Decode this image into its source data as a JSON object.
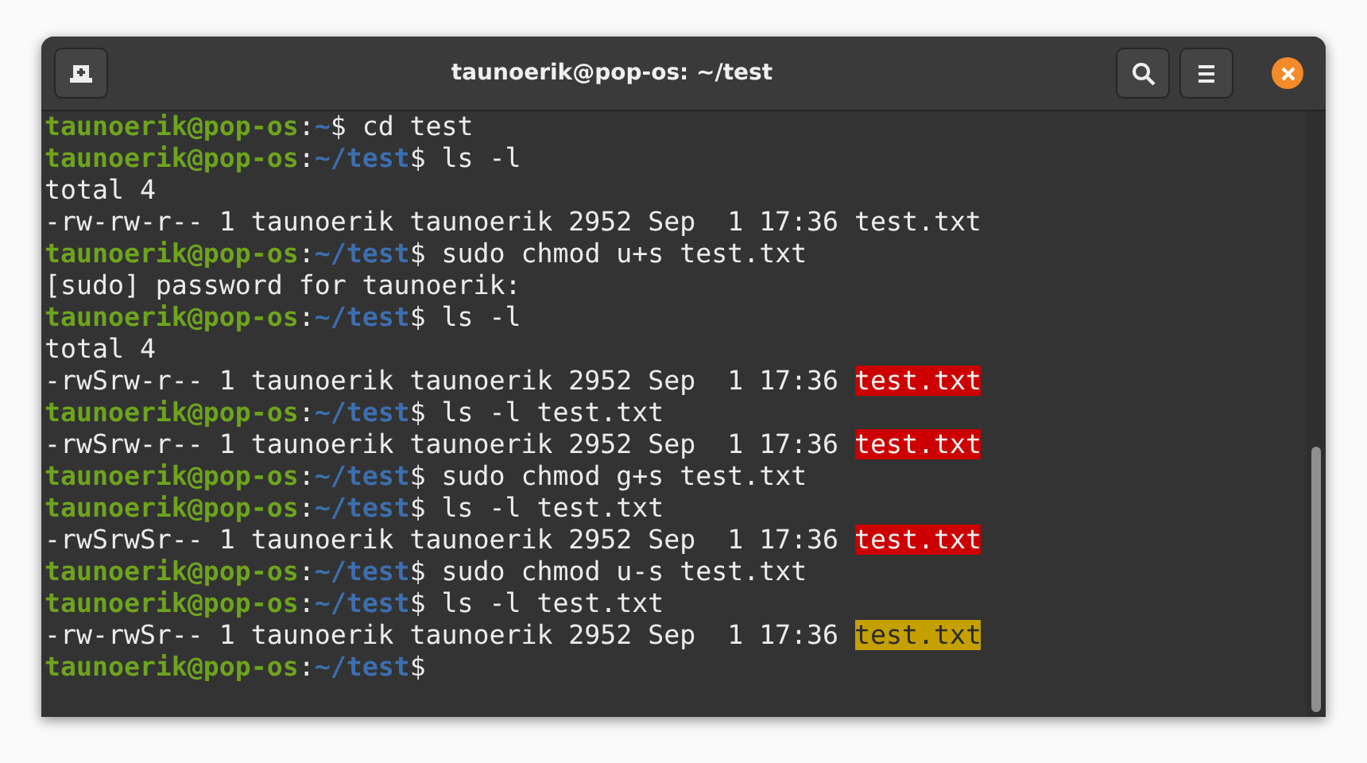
{
  "window": {
    "title": "taunoerik@pop-os: ~/test"
  },
  "terminal": {
    "lines": [
      {
        "segments": [
          {
            "text": "taunoerik@pop-os",
            "kind": "user"
          },
          {
            "text": ":",
            "kind": "plain"
          },
          {
            "text": "~",
            "kind": "path"
          },
          {
            "text": "$ cd test",
            "kind": "plain"
          }
        ]
      },
      {
        "segments": [
          {
            "text": "taunoerik@pop-os",
            "kind": "user"
          },
          {
            "text": ":",
            "kind": "plain"
          },
          {
            "text": "~/test",
            "kind": "path"
          },
          {
            "text": "$ ls -l",
            "kind": "plain"
          }
        ]
      },
      {
        "segments": [
          {
            "text": "total 4",
            "kind": "plain"
          }
        ]
      },
      {
        "segments": [
          {
            "text": "-rw-rw-r-- 1 taunoerik taunoerik 2952 Sep  1 17:36 test.txt",
            "kind": "plain"
          }
        ]
      },
      {
        "segments": [
          {
            "text": "taunoerik@pop-os",
            "kind": "user"
          },
          {
            "text": ":",
            "kind": "plain"
          },
          {
            "text": "~/test",
            "kind": "path"
          },
          {
            "text": "$ sudo chmod u+s test.txt",
            "kind": "plain"
          }
        ]
      },
      {
        "segments": [
          {
            "text": "[sudo] password for taunoerik:",
            "kind": "plain"
          }
        ]
      },
      {
        "segments": [
          {
            "text": "taunoerik@pop-os",
            "kind": "user"
          },
          {
            "text": ":",
            "kind": "plain"
          },
          {
            "text": "~/test",
            "kind": "path"
          },
          {
            "text": "$ ls -l",
            "kind": "plain"
          }
        ]
      },
      {
        "segments": [
          {
            "text": "total 4",
            "kind": "plain"
          }
        ]
      },
      {
        "segments": [
          {
            "text": "-rwSrw-r-- 1 taunoerik taunoerik 2952 Sep  1 17:36 ",
            "kind": "plain"
          },
          {
            "text": "test.txt",
            "kind": "setuid"
          }
        ]
      },
      {
        "segments": [
          {
            "text": "taunoerik@pop-os",
            "kind": "user"
          },
          {
            "text": ":",
            "kind": "plain"
          },
          {
            "text": "~/test",
            "kind": "path"
          },
          {
            "text": "$ ls -l test.txt",
            "kind": "plain"
          }
        ]
      },
      {
        "segments": [
          {
            "text": "-rwSrw-r-- 1 taunoerik taunoerik 2952 Sep  1 17:36 ",
            "kind": "plain"
          },
          {
            "text": "test.txt",
            "kind": "setuid"
          }
        ]
      },
      {
        "segments": [
          {
            "text": "taunoerik@pop-os",
            "kind": "user"
          },
          {
            "text": ":",
            "kind": "plain"
          },
          {
            "text": "~/test",
            "kind": "path"
          },
          {
            "text": "$ sudo chmod g+s test.txt",
            "kind": "plain"
          }
        ]
      },
      {
        "segments": [
          {
            "text": "taunoerik@pop-os",
            "kind": "user"
          },
          {
            "text": ":",
            "kind": "plain"
          },
          {
            "text": "~/test",
            "kind": "path"
          },
          {
            "text": "$ ls -l test.txt",
            "kind": "plain"
          }
        ]
      },
      {
        "segments": [
          {
            "text": "-rwSrwSr-- 1 taunoerik taunoerik 2952 Sep  1 17:36 ",
            "kind": "plain"
          },
          {
            "text": "test.txt",
            "kind": "setuid"
          }
        ]
      },
      {
        "segments": [
          {
            "text": "taunoerik@pop-os",
            "kind": "user"
          },
          {
            "text": ":",
            "kind": "plain"
          },
          {
            "text": "~/test",
            "kind": "path"
          },
          {
            "text": "$ sudo chmod u-s test.txt",
            "kind": "plain"
          }
        ]
      },
      {
        "segments": [
          {
            "text": "taunoerik@pop-os",
            "kind": "user"
          },
          {
            "text": ":",
            "kind": "plain"
          },
          {
            "text": "~/test",
            "kind": "path"
          },
          {
            "text": "$ ls -l test.txt",
            "kind": "plain"
          }
        ]
      },
      {
        "segments": [
          {
            "text": "-rw-rwSr-- 1 taunoerik taunoerik 2952 Sep  1 17:36 ",
            "kind": "plain"
          },
          {
            "text": "test.txt",
            "kind": "setgid"
          }
        ]
      },
      {
        "segments": [
          {
            "text": "taunoerik@pop-os",
            "kind": "user"
          },
          {
            "text": ":",
            "kind": "plain"
          },
          {
            "text": "~/test",
            "kind": "path"
          },
          {
            "text": "$",
            "kind": "plain"
          }
        ]
      }
    ]
  }
}
